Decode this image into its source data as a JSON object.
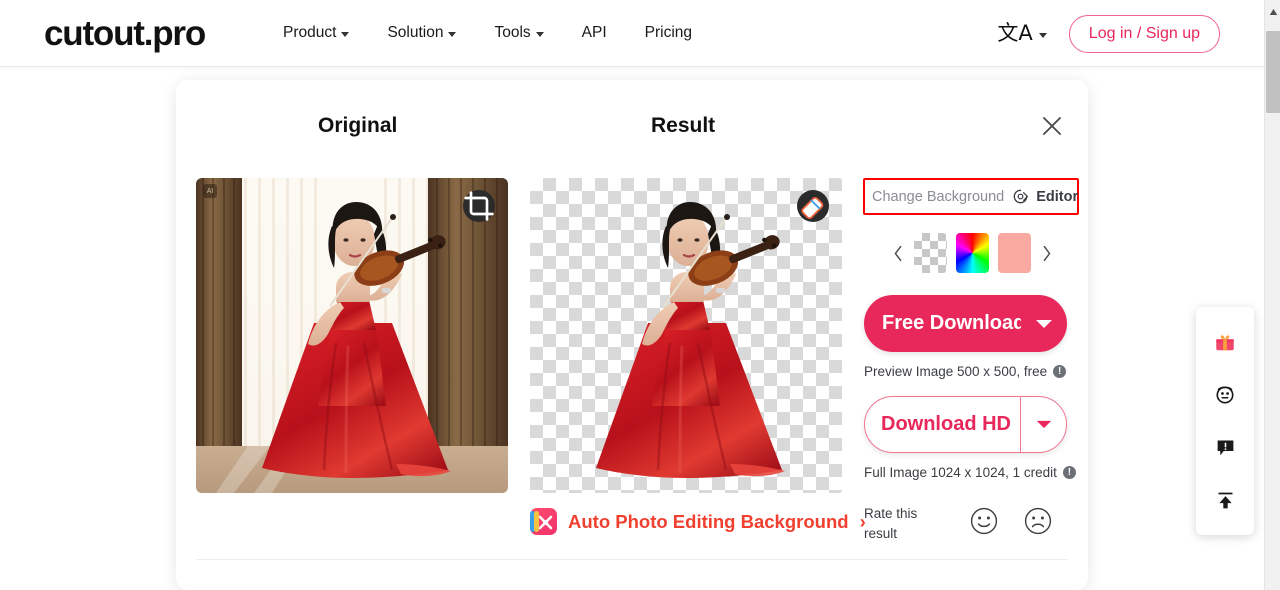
{
  "header": {
    "logo": "cutout.pro",
    "nav": [
      {
        "label": "Product",
        "has_caret": true
      },
      {
        "label": "Solution",
        "has_caret": true
      },
      {
        "label": "Tools",
        "has_caret": true
      },
      {
        "label": "API",
        "has_caret": false
      },
      {
        "label": "Pricing",
        "has_caret": false
      }
    ],
    "language_glyph": "文A",
    "login_label": "Log in / Sign up"
  },
  "card": {
    "original_title": "Original",
    "result_title": "Result",
    "close_label": "×",
    "original_image": {
      "ai_badge": "AI",
      "tool_icon": "crop-icon",
      "alt": "Woman in red gown playing violin in front of curtains"
    },
    "result_image": {
      "tool_icon": "eraser-icon",
      "alt": "Woman in red gown playing violin on transparent background"
    }
  },
  "panel": {
    "change_background_label": "Change Background",
    "editor_label": "Editor",
    "highlight_color": "#ff0000",
    "swatches": [
      {
        "name": "transparent",
        "kind": "checkerboard"
      },
      {
        "name": "color-picker",
        "kind": "rainbow"
      },
      {
        "name": "salmon",
        "kind": "solid",
        "color": "#f9a9a0"
      }
    ],
    "prev_arrow": "‹",
    "next_arrow": "›",
    "free_download_label": "Free Download",
    "free_download_caption": "Preview Image 500 x 500, free",
    "download_hd_label": "Download HD",
    "download_hd_caption": "Full Image 1024 x 1024, 1 credit",
    "info_symbol": "!",
    "rate_label": "Rate this result",
    "rate_positive": "smiley-happy-icon",
    "rate_negative": "smiley-sad-icon",
    "accent_color": "#e8275a"
  },
  "auto_link": {
    "label": "Auto Photo Editing Background",
    "chevron": "›"
  },
  "side_widget": {
    "items": [
      {
        "name": "gift-icon"
      },
      {
        "name": "avatar-icon"
      },
      {
        "name": "feedback-icon"
      },
      {
        "name": "scroll-to-top-icon"
      }
    ]
  },
  "scrollbar": {
    "up_arrow": "▲"
  }
}
